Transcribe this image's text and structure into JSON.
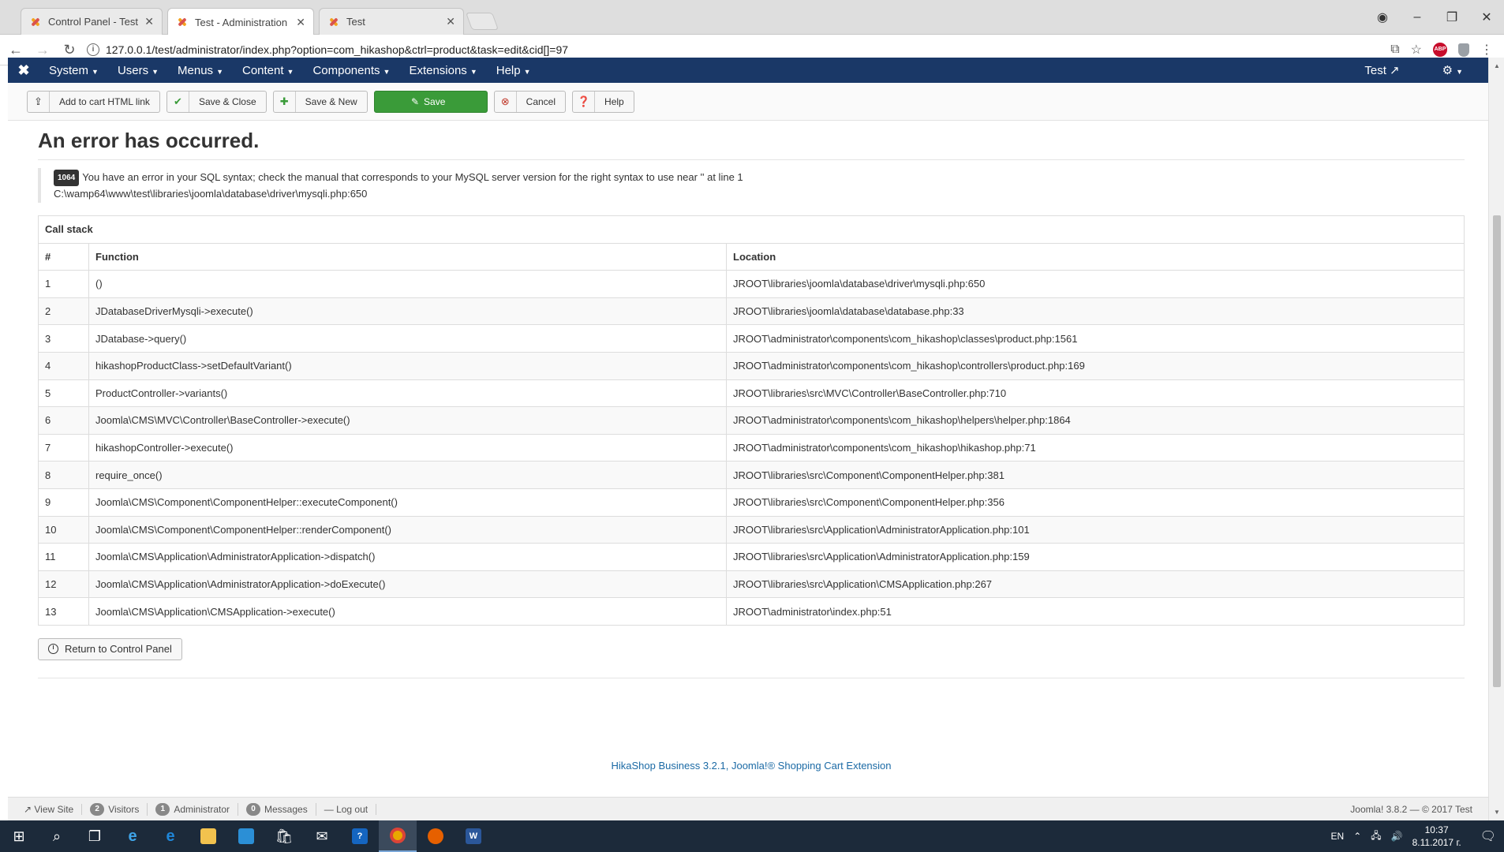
{
  "browser": {
    "tabs": [
      {
        "title": "Control Panel - Test - Ad"
      },
      {
        "title": "Test - Administration - P"
      },
      {
        "title": "Test"
      }
    ],
    "url": "127.0.0.1/test/administrator/index.php?option=com_hikashop&ctrl=product&task=edit&cid[]=97",
    "window_controls": {
      "minimize": "–",
      "restore": "❐",
      "close": "✕"
    }
  },
  "admin_nav": {
    "menus": [
      "System",
      "Users",
      "Menus",
      "Content",
      "Components",
      "Extensions",
      "Help"
    ],
    "site_link": "Test"
  },
  "toolbar": {
    "add_to_cart": "Add to cart HTML link",
    "save_close": "Save & Close",
    "save_new": "Save & New",
    "save": "Save",
    "cancel": "Cancel",
    "help": "Help"
  },
  "error": {
    "title": "An error has occurred.",
    "code": "1064",
    "message": "You have an error in your SQL syntax; check the manual that corresponds to your MySQL server version for the right syntax to use near '' at line 1",
    "path": "C:\\wamp64\\www\\test\\libraries\\joomla\\database\\driver\\mysqli.php:650"
  },
  "callstack": {
    "caption": "Call stack",
    "headers": {
      "num": "#",
      "function": "Function",
      "location": "Location"
    },
    "rows": [
      {
        "num": "1",
        "fn": "()",
        "loc": "JROOT\\libraries\\joomla\\database\\driver\\mysqli.php:650"
      },
      {
        "num": "2",
        "fn": "JDatabaseDriverMysqli->execute()",
        "loc": "JROOT\\libraries\\joomla\\database\\database.php:33"
      },
      {
        "num": "3",
        "fn": "JDatabase->query()",
        "loc": "JROOT\\administrator\\components\\com_hikashop\\classes\\product.php:1561"
      },
      {
        "num": "4",
        "fn": "hikashopProductClass->setDefaultVariant()",
        "loc": "JROOT\\administrator\\components\\com_hikashop\\controllers\\product.php:169"
      },
      {
        "num": "5",
        "fn": "ProductController->variants()",
        "loc": "JROOT\\libraries\\src\\MVC\\Controller\\BaseController.php:710"
      },
      {
        "num": "6",
        "fn": "Joomla\\CMS\\MVC\\Controller\\BaseController->execute()",
        "loc": "JROOT\\administrator\\components\\com_hikashop\\helpers\\helper.php:1864"
      },
      {
        "num": "7",
        "fn": "hikashopController->execute()",
        "loc": "JROOT\\administrator\\components\\com_hikashop\\hikashop.php:71"
      },
      {
        "num": "8",
        "fn": "require_once()",
        "loc": "JROOT\\libraries\\src\\Component\\ComponentHelper.php:381"
      },
      {
        "num": "9",
        "fn": "Joomla\\CMS\\Component\\ComponentHelper::executeComponent()",
        "loc": "JROOT\\libraries\\src\\Component\\ComponentHelper.php:356"
      },
      {
        "num": "10",
        "fn": "Joomla\\CMS\\Component\\ComponentHelper::renderComponent()",
        "loc": "JROOT\\libraries\\src\\Application\\AdministratorApplication.php:101"
      },
      {
        "num": "11",
        "fn": "Joomla\\CMS\\Application\\AdministratorApplication->dispatch()",
        "loc": "JROOT\\libraries\\src\\Application\\AdministratorApplication.php:159"
      },
      {
        "num": "12",
        "fn": "Joomla\\CMS\\Application\\AdministratorApplication->doExecute()",
        "loc": "JROOT\\libraries\\src\\Application\\CMSApplication.php:267"
      },
      {
        "num": "13",
        "fn": "Joomla\\CMS\\Application\\CMSApplication->execute()",
        "loc": "JROOT\\administrator\\index.php:51"
      }
    ]
  },
  "return_button": "Return to Control Panel",
  "footer_link": "HikaShop Business 3.2.1, Joomla!® Shopping Cart Extension",
  "statusbar": {
    "view_site": "View Site",
    "visitors_count": "2",
    "visitors": "Visitors",
    "admin_count": "1",
    "administrator": "Administrator",
    "messages_count": "0",
    "messages": "Messages",
    "logout": "Log out",
    "version": "Joomla! 3.8.2 — © 2017 Test"
  },
  "taskbar": {
    "lang": "EN",
    "time": "10:37",
    "date": "8.11.2017 г."
  },
  "colors": {
    "nav_bg": "#1a3867",
    "save_green": "#3a9b39",
    "link_blue": "#1b6aa5",
    "taskbar_bg": "#1c2a3a"
  }
}
